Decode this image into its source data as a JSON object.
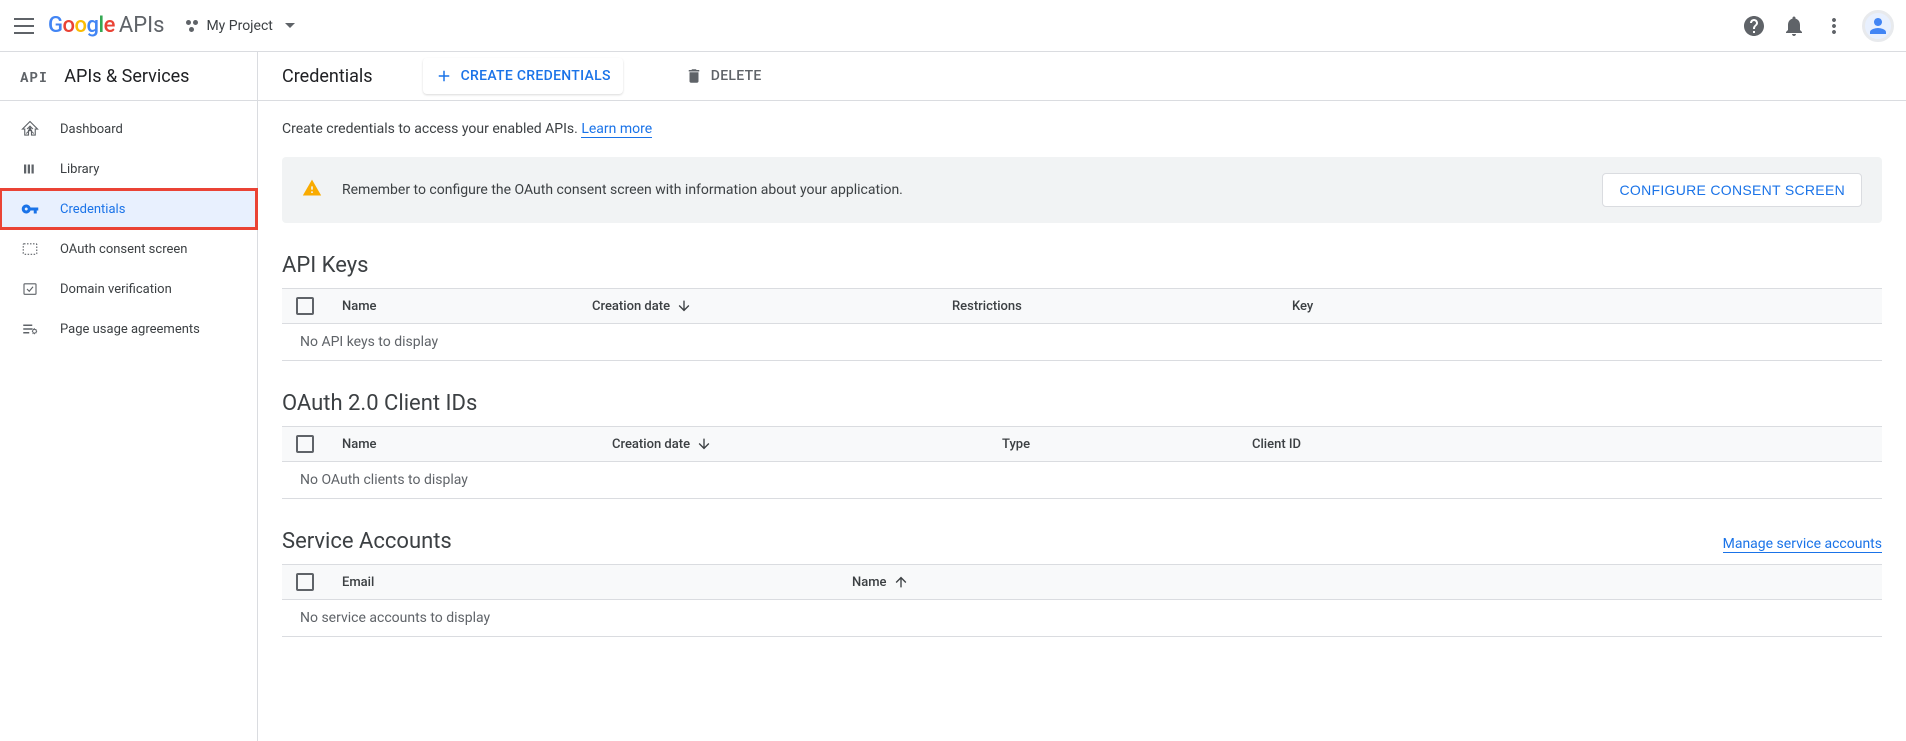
{
  "header": {
    "project_name": "My Project",
    "logo_apis": "APIs"
  },
  "sidebar": {
    "badge": "API",
    "title": "APIs & Services",
    "items": [
      {
        "label": "Dashboard"
      },
      {
        "label": "Library"
      },
      {
        "label": "Credentials"
      },
      {
        "label": "OAuth consent screen"
      },
      {
        "label": "Domain verification"
      },
      {
        "label": "Page usage agreements"
      }
    ]
  },
  "page": {
    "title": "Credentials",
    "create_btn": "CREATE CREDENTIALS",
    "delete_btn": "DELETE",
    "intro_text": "Create credentials to access your enabled APIs. ",
    "intro_link": "Learn more",
    "banner_text": "Remember to configure the OAuth consent screen with information about your application.",
    "banner_btn": "CONFIGURE CONSENT SCREEN"
  },
  "sections": {
    "api_keys": {
      "title": "API Keys",
      "cols": {
        "name": "Name",
        "date": "Creation date",
        "restrictions": "Restrictions",
        "key": "Key"
      },
      "empty": "No API keys to display"
    },
    "oauth": {
      "title": "OAuth 2.0 Client IDs",
      "cols": {
        "name": "Name",
        "date": "Creation date",
        "type": "Type",
        "client_id": "Client ID"
      },
      "empty": "No OAuth clients to display"
    },
    "service": {
      "title": "Service Accounts",
      "manage": "Manage service accounts",
      "cols": {
        "email": "Email",
        "name": "Name"
      },
      "empty": "No service accounts to display"
    }
  }
}
